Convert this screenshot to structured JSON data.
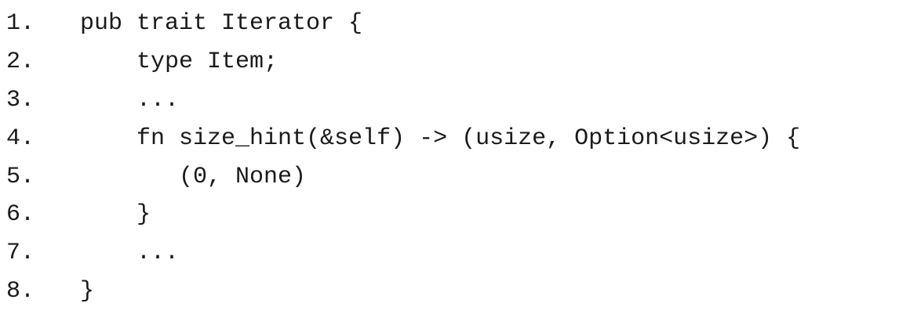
{
  "code": {
    "lines": [
      {
        "number": "1.",
        "text": " pub trait Iterator {"
      },
      {
        "number": "2.",
        "text": "     type Item;"
      },
      {
        "number": "3.",
        "text": "     ..."
      },
      {
        "number": "4.",
        "text": "     fn size_hint(&self) -> (usize, Option<usize>) {"
      },
      {
        "number": "5.",
        "text": "        (0, None)"
      },
      {
        "number": "6.",
        "text": "     }"
      },
      {
        "number": "7.",
        "text": "     ..."
      },
      {
        "number": "8.",
        "text": " }"
      }
    ]
  }
}
